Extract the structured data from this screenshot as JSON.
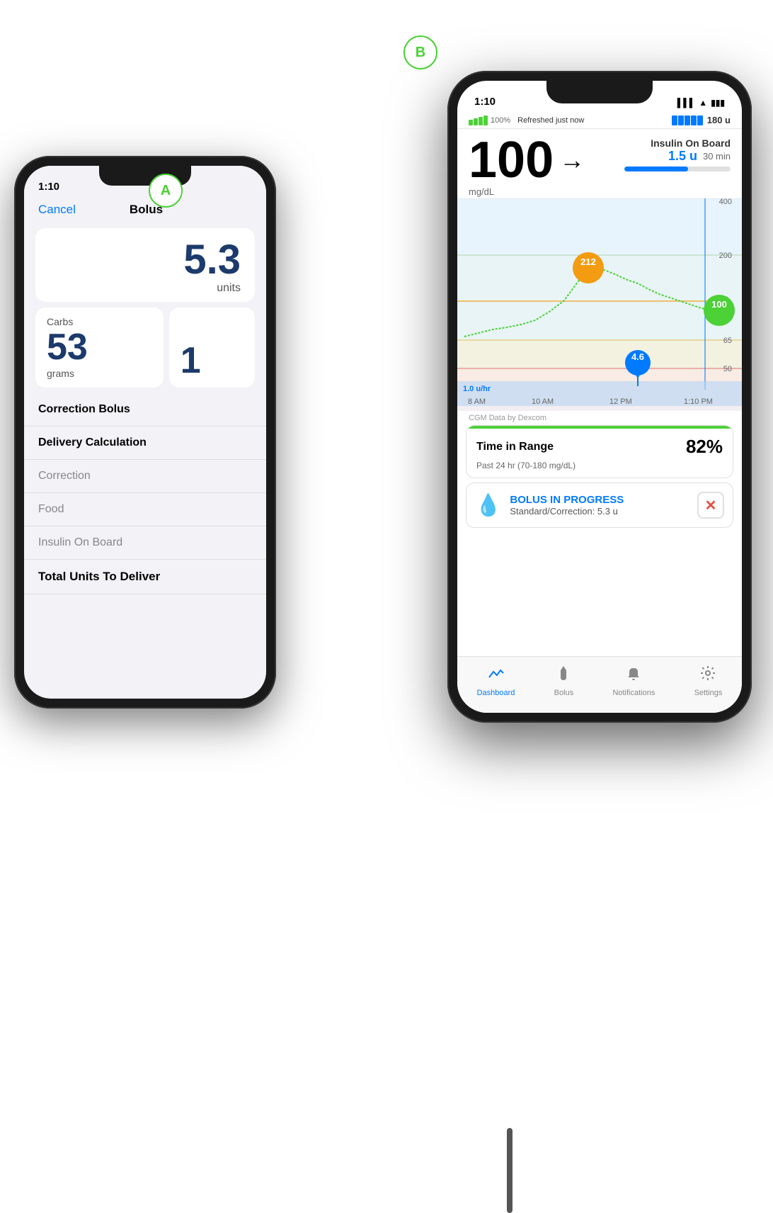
{
  "labels": {
    "a": "A",
    "b": "B"
  },
  "phone_a": {
    "time": "1:10",
    "nav": {
      "cancel": "Cancel",
      "title": "Bolus"
    },
    "bolus": {
      "value": "5.3",
      "unit": "units"
    },
    "carbs": {
      "label": "Carbs",
      "value": "53",
      "unit": "grams",
      "value2": "1"
    },
    "sections": [
      {
        "label": "Correction Bolus",
        "type": "header"
      },
      {
        "label": "Delivery Calculation",
        "type": "header"
      },
      {
        "label": "Correction",
        "type": "sub"
      },
      {
        "label": "Food",
        "type": "sub"
      },
      {
        "label": "Insulin On Board",
        "type": "sub"
      },
      {
        "label": "Total Units To Deliver",
        "type": "bold"
      }
    ]
  },
  "phone_b": {
    "time": "1:10",
    "status": {
      "refreshed": "Refreshed just now",
      "units": "180 u"
    },
    "glucose": {
      "value": "100",
      "unit": "mg/dL",
      "arrow": "→"
    },
    "iob": {
      "title": "Insulin On Board",
      "value": "1.5 u",
      "time": "30 min"
    },
    "chart": {
      "basal_rate": "1.0 u/hr",
      "bolus_value": "4.6",
      "times": [
        "8 AM",
        "10 AM",
        "12 PM",
        "1:10 PM"
      ],
      "y_labels": [
        "400",
        "200",
        "65",
        "50"
      ],
      "current_value": "100",
      "peak_value": "212"
    },
    "cgm_credit": "CGM Data by Dexcom",
    "time_in_range": {
      "label": "Time in Range",
      "percent": "82%",
      "sub": "Past 24 hr (70-180 mg/dL)"
    },
    "bolus_progress": {
      "title": "BOLUS IN PROGRESS",
      "sub": "Standard/Correction: 5.3 u"
    },
    "tabs": [
      {
        "label": "Dashboard",
        "active": true,
        "icon": "📈"
      },
      {
        "label": "Bolus",
        "active": false,
        "icon": "💧"
      },
      {
        "label": "Notifications",
        "active": false,
        "icon": "🔔"
      },
      {
        "label": "Settings",
        "active": false,
        "icon": "⚙️"
      }
    ]
  }
}
